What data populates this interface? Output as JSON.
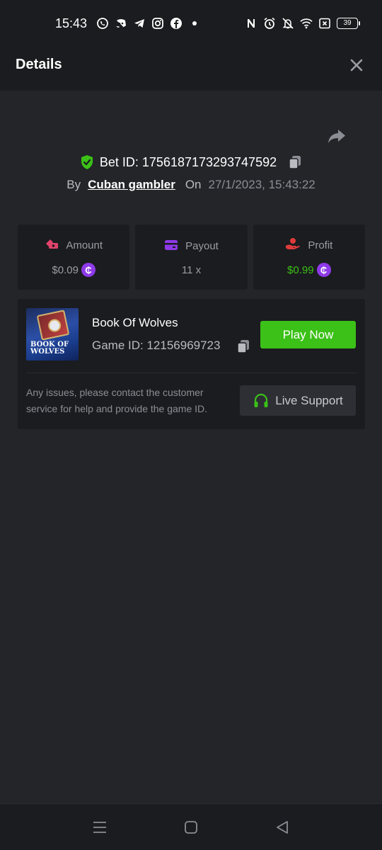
{
  "status_bar": {
    "time": "15:43",
    "left_icons": [
      "whatsapp-icon",
      "discord-icon",
      "telegram-icon",
      "instagram-icon",
      "facebook-icon",
      "dot-icon"
    ],
    "right_icons": [
      "nfc-icon",
      "alarm-icon",
      "mute-icon",
      "wifi-icon",
      "sim-icon"
    ],
    "battery": "39"
  },
  "header": {
    "title": "Details",
    "close_icon": "close-icon"
  },
  "bet": {
    "id_label": "Bet ID: 1756187173293747592",
    "by_label": "By",
    "user": "Cuban gambler",
    "on_label": "On",
    "date": "27/1/2023, 15:43:22"
  },
  "stats": [
    {
      "label": "Amount",
      "value": "$0.09",
      "icon": "amount-icon",
      "color": "#e0436b",
      "coin": true
    },
    {
      "label": "Payout",
      "value": "11 x",
      "icon": "wallet-icon",
      "color": "#8e3ae8",
      "coin": false
    },
    {
      "label": "Profit",
      "value": "$0.99",
      "icon": "profit-icon",
      "color": "#e03b3b",
      "coin": true
    }
  ],
  "coin_symbol": "₵",
  "game": {
    "title": "Book Of Wolves",
    "id_label": "Game ID: 12156969723",
    "thumb_text": "BOOK OF WOLVES",
    "play_label": "Play Now",
    "help_text": "Any issues, please contact the customer service for help and provide the game ID.",
    "support_label": "Live Support"
  },
  "colors": {
    "accent_green": "#3bc117",
    "coin_purple": "#8e3ae8",
    "background": "#232529",
    "card": "#1b1c1f"
  },
  "navbar": [
    "menu-icon",
    "home-icon",
    "back-icon"
  ]
}
